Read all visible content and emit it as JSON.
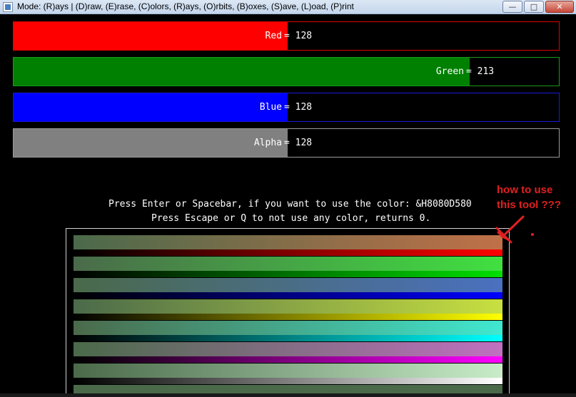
{
  "window": {
    "title": "Mode: (R)ays | (D)raw, (E)rase, (C)olors, (R)ays, (O)rbits, (B)oxes, (S)ave, (L)oad, (P)rint",
    "minimize_label": "—",
    "maximize_label": "□",
    "close_label": "✕"
  },
  "channels": [
    {
      "name": "Red",
      "equals": "= 128",
      "value": 128,
      "fill_fraction": 0.502,
      "color": "#ff0000"
    },
    {
      "name": "Green",
      "equals": "= 213",
      "value": 213,
      "fill_fraction": 0.836,
      "color": "#008000"
    },
    {
      "name": "Blue",
      "equals": "= 128",
      "value": 128,
      "fill_fraction": 0.502,
      "color": "#0000ff"
    },
    {
      "name": "Alpha",
      "equals": "= 128",
      "value": 128,
      "fill_fraction": 0.502,
      "color": "#808080"
    }
  ],
  "instructions": {
    "line1": "Press Enter or Spacebar, if you want to use the color: &H8080D580",
    "line2": "Press Escape or Q to not use any color, returns 0."
  },
  "palette_rows": [
    {
      "main_start": "#4a6a4a",
      "main_end": "#c07048",
      "sub_start": "#000000",
      "sub_end": "#ff0000"
    },
    {
      "main_start": "#4a6a4a",
      "main_end": "#40e040",
      "sub_start": "#000000",
      "sub_end": "#00e000"
    },
    {
      "main_start": "#4a6a4a",
      "main_end": "#4a70c0",
      "sub_start": "#000000",
      "sub_end": "#0000ff"
    },
    {
      "main_start": "#4a6a4a",
      "main_end": "#c8e040",
      "sub_start": "#000000",
      "sub_end": "#ffff00"
    },
    {
      "main_start": "#4a6a4a",
      "main_end": "#40e8d0",
      "sub_start": "#000000",
      "sub_end": "#00ffff"
    },
    {
      "main_start": "#4a6a4a",
      "main_end": "#c070c0",
      "sub_start": "#000000",
      "sub_end": "#ff00ff"
    },
    {
      "main_start": "#4a6a4a",
      "main_end": "#c8ecc8",
      "sub_start": "#000000",
      "sub_end": "#ffffff"
    },
    {
      "main_start": "#4a6a4a",
      "main_end": "#4a6a4a",
      "sub_start": "#000000",
      "sub_end": "#404040"
    }
  ],
  "annotation": {
    "line1": "how to use",
    "line2": "this tool ???",
    "color": "#e02020"
  }
}
